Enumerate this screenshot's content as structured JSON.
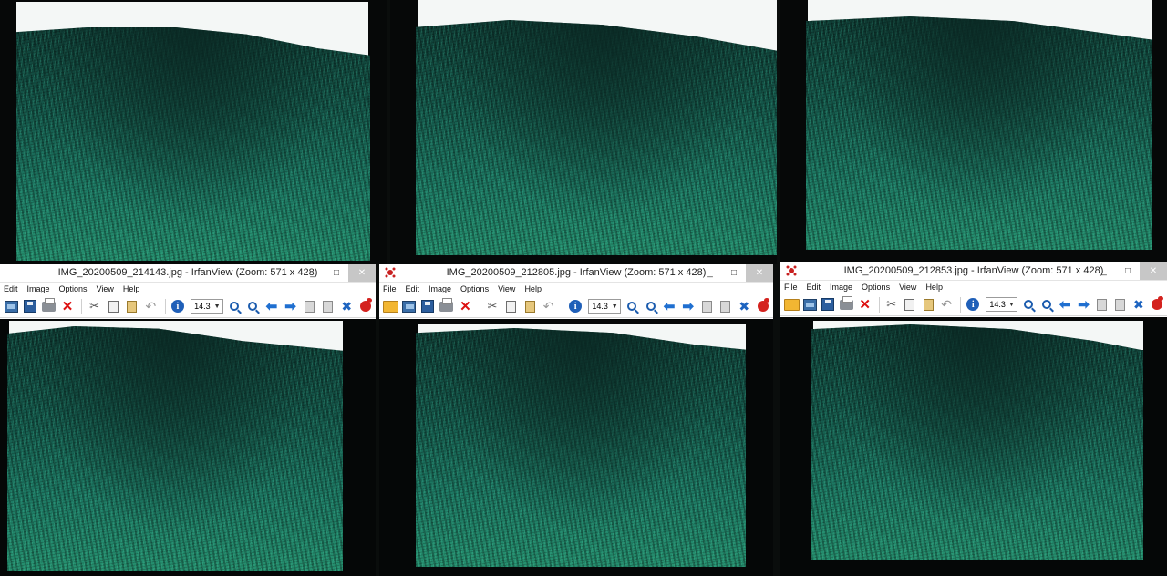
{
  "windows": [
    {
      "title": "IMG_20200509_214143.jpg - IrfanView (Zoom: 571 x 428)",
      "menu": [
        "Edit",
        "Image",
        "Options",
        "View",
        "Help"
      ],
      "zoom": "14.3",
      "controls": {
        "minimize": "_",
        "maximize": "□",
        "close": "✕"
      }
    },
    {
      "title": "IMG_20200509_212805.jpg - IrfanView (Zoom: 571 x 428)",
      "menu": [
        "File",
        "Edit",
        "Image",
        "Options",
        "View",
        "Help"
      ],
      "zoom": "14.3",
      "controls": {
        "minimize": "_",
        "maximize": "□",
        "close": "✕"
      }
    },
    {
      "title": "IMG_20200509_212853.jpg - IrfanView (Zoom: 571 x 428)",
      "menu": [
        "File",
        "Edit",
        "Image",
        "Options",
        "View",
        "Help"
      ],
      "zoom": "14.3",
      "controls": {
        "minimize": "_",
        "maximize": "□",
        "close": "✕"
      }
    }
  ],
  "toolbar_icons": [
    "open-icon",
    "thumbnails-icon",
    "save-icon",
    "print-icon",
    "delete-icon",
    "cut-icon",
    "copy-icon",
    "paste-icon",
    "undo-icon",
    "info-icon",
    "zoom-in-icon",
    "zoom-out-icon",
    "previous-icon",
    "next-icon",
    "page-first-icon",
    "page-last-icon",
    "settings-icon",
    "exit-icon"
  ],
  "colors": {
    "grass_dark": "#0f3e36",
    "grass_light": "#25906f",
    "sky": "#f4f7f6",
    "close_button": "#c7c7c7"
  }
}
